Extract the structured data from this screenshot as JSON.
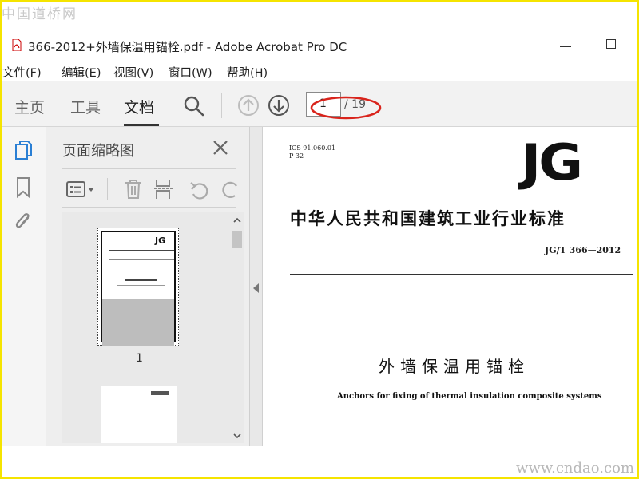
{
  "watermarks": {
    "top_left": "中国道桥网",
    "bottom_right": "www.cndao.com"
  },
  "window": {
    "title": "366-2012+外墙保温用锚栓.pdf - Adobe Acrobat Pro DC"
  },
  "menu": [
    "文件(F)",
    "编辑(E)",
    "视图(V)",
    "窗口(W)",
    "帮助(H)"
  ],
  "tabs": [
    "主页",
    "工具",
    "文档"
  ],
  "active_tab": "文档",
  "page_nav": {
    "current": "1",
    "total_label": "/ 19"
  },
  "thumbnail_panel": {
    "title": "页面缩略图",
    "pages": [
      "1"
    ]
  },
  "document": {
    "ics": "ICS 91.060.01",
    "p": "P 32",
    "logo": "JG",
    "standard_title": "中华人民共和国建筑工业行业标准",
    "code": "JG/T 366—2012",
    "title": "外墙保温用锚栓",
    "subtitle": "Anchors for fixing of thermal insulation composite systems"
  },
  "colors": {
    "frame": "#f5e400",
    "annotation": "#d9241c",
    "toolbar": "#f2f2f2",
    "rail_icon_active": "#2a7fd4"
  }
}
